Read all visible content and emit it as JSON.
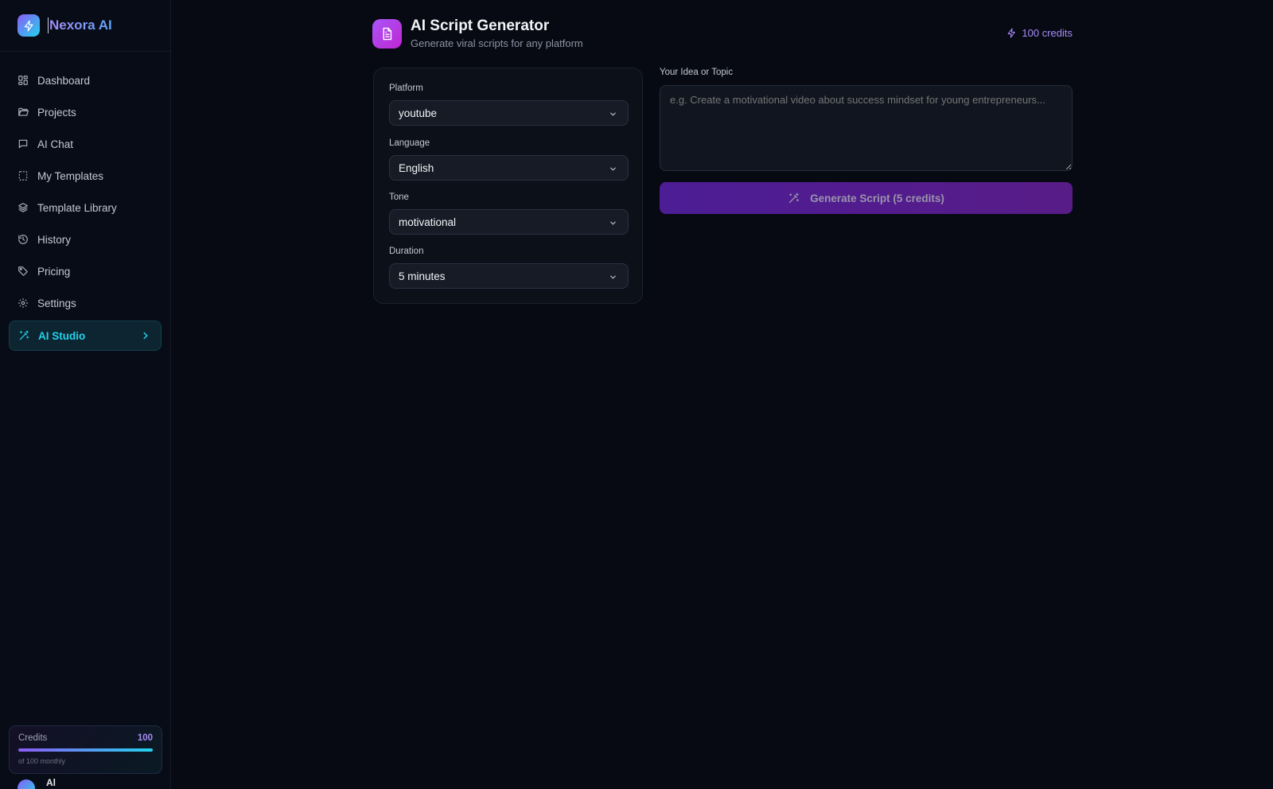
{
  "brand": {
    "name": "Nexora AI",
    "logo_icon": "bolt-icon"
  },
  "sidebar": {
    "items": [
      {
        "label": "Dashboard",
        "icon": "dashboard-icon"
      },
      {
        "label": "Projects",
        "icon": "folder-icon"
      },
      {
        "label": "AI Chat",
        "icon": "chat-icon"
      },
      {
        "label": "My Templates",
        "icon": "template-icon"
      },
      {
        "label": "Template Library",
        "icon": "layers-icon"
      },
      {
        "label": "History",
        "icon": "history-icon"
      },
      {
        "label": "Pricing",
        "icon": "tag-icon"
      },
      {
        "label": "Settings",
        "icon": "gear-icon"
      },
      {
        "label": "AI Studio",
        "icon": "wand-icon",
        "active": true
      }
    ],
    "credits": {
      "label": "Credits",
      "value": "100",
      "sub": "of 100 monthly",
      "fraction": 1.0
    },
    "user": {
      "name": "Al"
    }
  },
  "header": {
    "title": "AI Script Generator",
    "subtitle": "Generate viral scripts for any platform",
    "credits": "100 credits"
  },
  "form": {
    "platform": {
      "label": "Platform",
      "value": "youtube"
    },
    "language": {
      "label": "Language",
      "value": "English"
    },
    "tone": {
      "label": "Tone",
      "value": "motivational"
    },
    "duration": {
      "label": "Duration",
      "value": "5 minutes"
    }
  },
  "idea": {
    "label": "Your Idea or Topic",
    "placeholder": "e.g. Create a motivational video about success mindset for young entrepreneurs..."
  },
  "generate_button": {
    "label": "Generate Script (5 credits)"
  },
  "colors": {
    "background": "#070a13",
    "accent_purple": "#a78bfa",
    "accent_cyan": "#22d3ee",
    "button": "#4c1d95"
  }
}
